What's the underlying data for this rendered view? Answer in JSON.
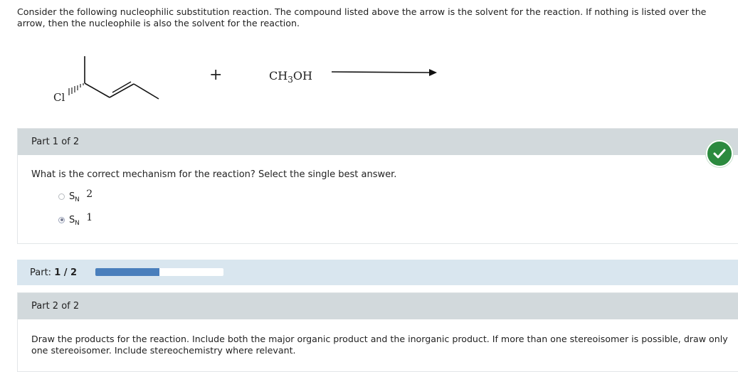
{
  "intro_text": "Consider the following nucleophilic substitution reaction. The compound listed above the arrow is the solvent for the reaction. If nothing is listed over the arrow, then the nucleophile is also the solvent for the reaction.",
  "reaction": {
    "plus": "+",
    "reagent_prefix": "CH",
    "reagent_sub": "3",
    "reagent_suffix": "OH",
    "halogen": "Cl"
  },
  "part1": {
    "header": "Part 1 of 2",
    "question": "What is the correct mechanism for the reaction? Select the single best answer.",
    "choices": [
      {
        "letter": "S",
        "sub": "N",
        "num": "2",
        "selected": false
      },
      {
        "letter": "S",
        "sub": "N",
        "num": "1",
        "selected": true
      }
    ],
    "status_color": "#2b8a3e"
  },
  "progress": {
    "label": "Part:",
    "value_text": "1 / 2",
    "fraction": 0.5,
    "fill_color": "#4a7fbc"
  },
  "part2": {
    "header": "Part 2 of 2",
    "description": "Draw the products for the reaction. Include both the major organic product and the inorganic product. If more than one stereoisomer is possible, draw only one stereoisomer. Include stereochemistry where relevant."
  }
}
